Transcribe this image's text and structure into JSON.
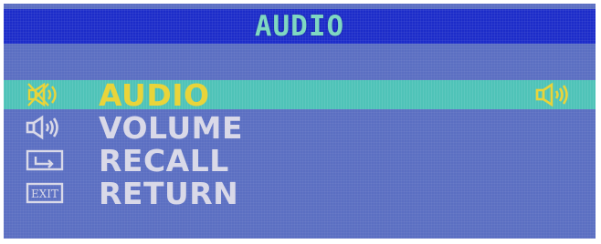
{
  "title": "AUDIO",
  "colors": {
    "panel": "#5b6fc2",
    "title_bar": "#1c2cc9",
    "title_text": "#7fd7c2",
    "highlight": "#4fc3b8",
    "selected_text": "#e9d43a",
    "item_text": "#d9d9e8"
  },
  "menu": {
    "items": [
      {
        "label": "AUDIO",
        "icon": "speaker-muted-icon",
        "selected": true
      },
      {
        "label": "VOLUME",
        "icon": "speaker-volume-icon",
        "selected": false
      },
      {
        "label": "RECALL",
        "icon": "recall-icon",
        "selected": false
      },
      {
        "label": "RETURN",
        "icon": "exit-icon",
        "icon_text": "EXIT",
        "selected": false
      }
    ],
    "selected_value_icon": "speaker-on-icon"
  }
}
